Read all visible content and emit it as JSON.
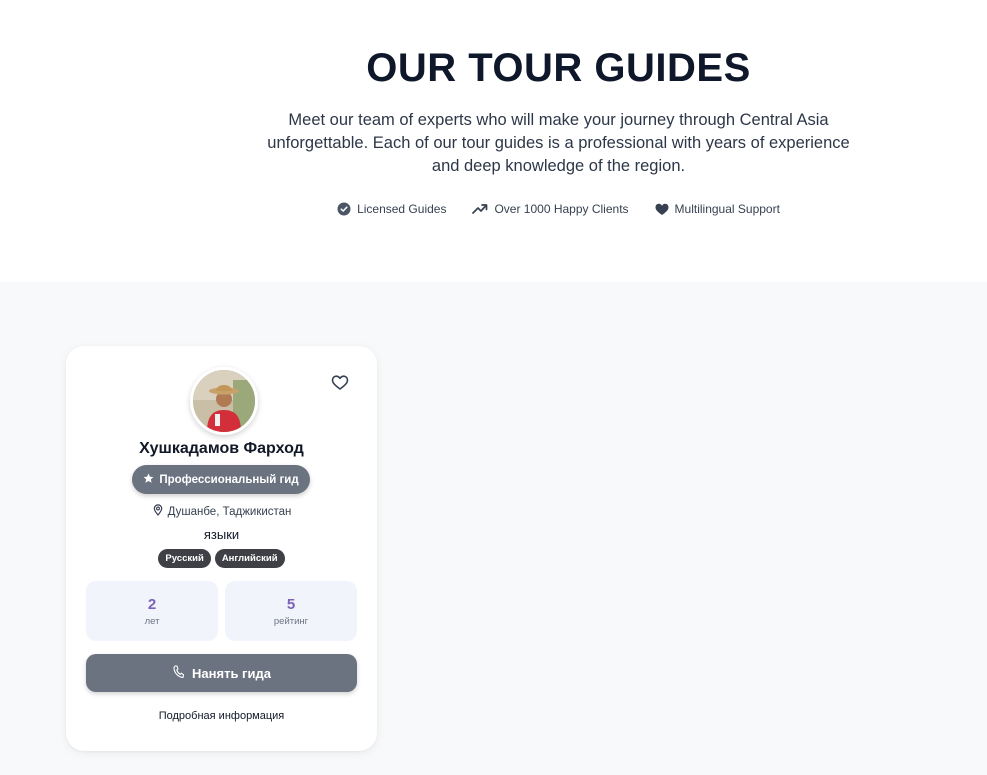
{
  "hero": {
    "title": "OUR TOUR GUIDES",
    "description": "Meet our team of experts who will make your journey through Central Asia unforgettable. Each of our tour guides is a professional with years of experience and deep knowledge of the region.",
    "features": [
      {
        "icon": "badge-check-icon",
        "label": "Licensed Guides"
      },
      {
        "icon": "trending-up-icon",
        "label": "Over 1000 Happy Clients"
      },
      {
        "icon": "heart-icon",
        "label": "Multilingual Support"
      }
    ]
  },
  "guide_card": {
    "name": "Хушкадамов Фарход",
    "badge": "Профессиональный гид",
    "location": "Душанбе, Таджикистан",
    "languages_label": "языки",
    "languages": [
      "Русский",
      "Английский"
    ],
    "stats": [
      {
        "value": "2",
        "label": "лет"
      },
      {
        "value": "5",
        "label": "рейтинг"
      }
    ],
    "hire_button": "Нанять гида",
    "details_link": "Подробная информация",
    "favorite_icon": "heart-outline-icon"
  },
  "colors": {
    "accent_stat": "#7c62b8",
    "button": "#6b7280",
    "chip": "#3f3f46",
    "stat_bg": "#f2f4fc",
    "section_bg": "#f8f9fb"
  }
}
